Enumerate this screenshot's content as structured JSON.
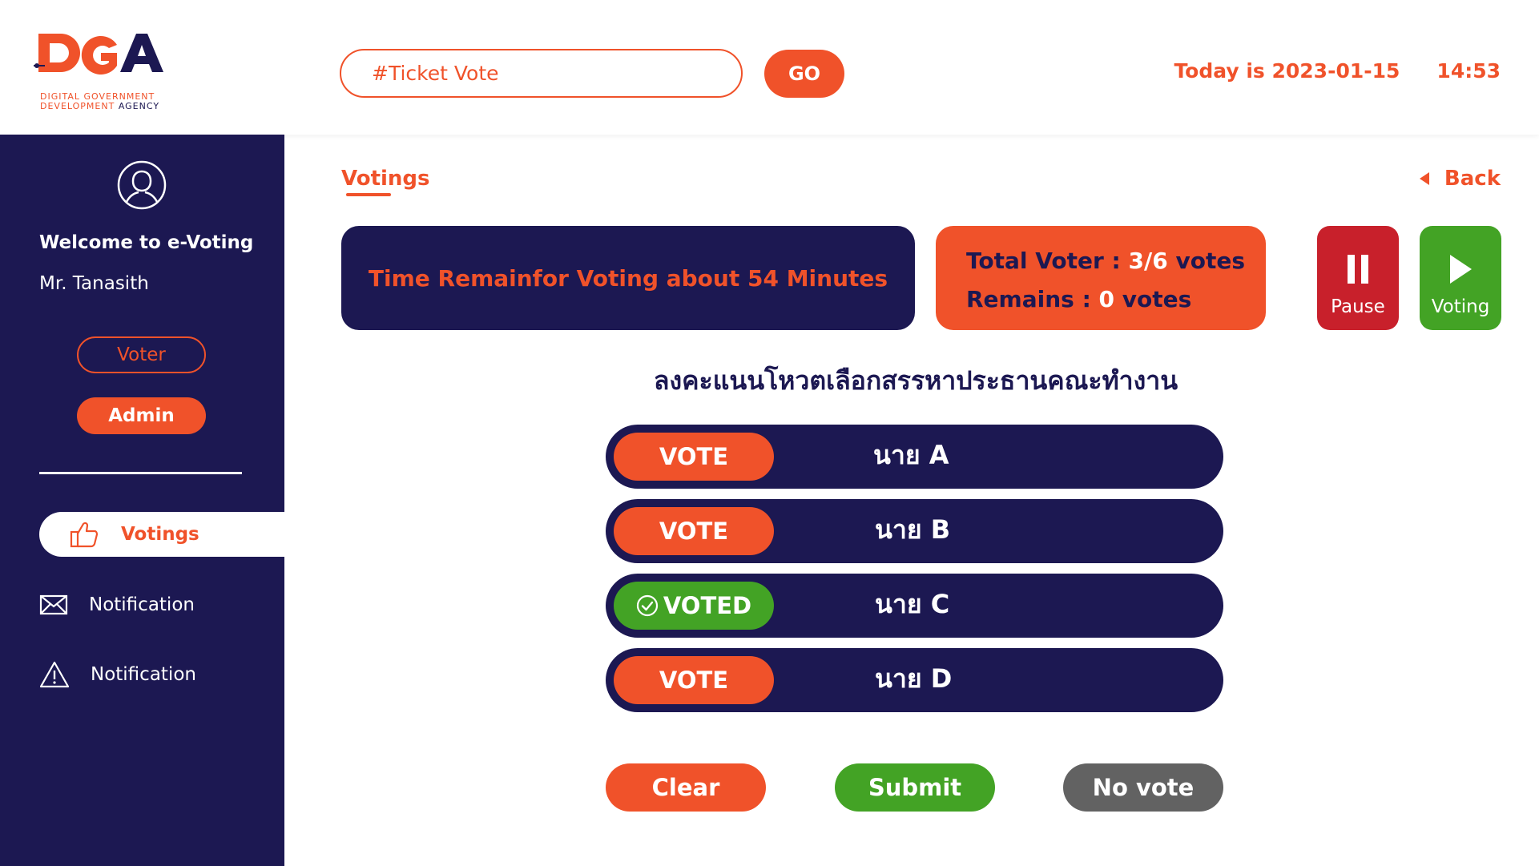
{
  "colors": {
    "brand_orange": "#F0522A",
    "navy": "#1C1852",
    "green": "#43A325",
    "red": "#C8202B",
    "gray": "#626262"
  },
  "header": {
    "logo_letters": "DGA",
    "logo_line1": "DIGITAL GOVERNMENT",
    "logo_line2_a": "DEVELOPMENT",
    "logo_line2_b": "AGENCY",
    "search_placeholder": "#Ticket Vote",
    "go_label": "GO",
    "date_text": "Today is 2023-01-15",
    "time_text": "14:53"
  },
  "sidebar": {
    "avatar_icon": "user-icon",
    "welcome": "Welcome to e-Voting",
    "user_name": "Mr. Tanasith",
    "role_voter": "Voter",
    "role_admin": "Admin",
    "nav": [
      {
        "label": "Votings",
        "icon": "thumbs-up-icon",
        "active": true
      },
      {
        "label": "Notification",
        "icon": "envelope-icon",
        "active": false
      },
      {
        "label": "Notification",
        "icon": "warning-icon",
        "active": false
      }
    ]
  },
  "main": {
    "page_title": "Votings",
    "back_label": "Back",
    "time_remaining": "Time Remainfor Voting about 54 Minutes",
    "voter_total_label": "Total Voter : ",
    "voter_total_value": "3/6",
    "voter_total_unit": " votes",
    "remains_label": "Remains : ",
    "remains_value": "0",
    "remains_unit": " votes",
    "pause_label": "Pause",
    "voting_label": "Voting",
    "question": "ลงคะแนนโหวตเลือกสรรหาประธานคณะทำงาน",
    "candidates": [
      {
        "button": "VOTE",
        "name": "นาย A",
        "voted": false
      },
      {
        "button": "VOTE",
        "name": "นาย B",
        "voted": false
      },
      {
        "button": "VOTED",
        "name": "นาย C",
        "voted": true
      },
      {
        "button": "VOTE",
        "name": "นาย D",
        "voted": false
      }
    ],
    "actions": {
      "clear": "Clear",
      "submit": "Submit",
      "no_vote": "No vote"
    }
  }
}
